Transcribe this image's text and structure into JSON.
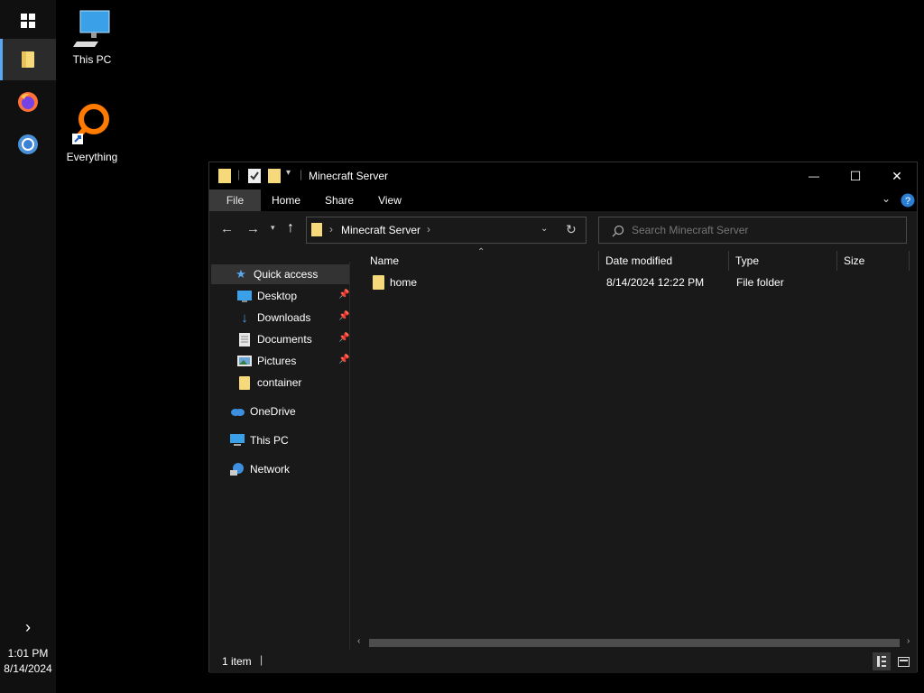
{
  "taskbar": {
    "start_icon": "windows-logo-icon",
    "apps": [
      "file-explorer-icon",
      "firefox-icon",
      "chrome-icon"
    ],
    "chevron": "›",
    "clock": {
      "time": "1:01 PM",
      "date": "8/14/2024"
    }
  },
  "desktop": {
    "icons": [
      {
        "label": "This PC",
        "icon": "computer-icon"
      },
      {
        "label": "Everything",
        "icon": "everything-search-icon"
      }
    ]
  },
  "window": {
    "title": "Minecraft Server",
    "controls": {
      "minimize": "—",
      "maximize": "☐",
      "close": "✕"
    },
    "ribbon_tabs": [
      "File",
      "Home",
      "Share",
      "View"
    ],
    "address": {
      "path": "Minecraft Server",
      "separator_before": "›",
      "separator_after": "›"
    },
    "search": {
      "placeholder": "Search Minecraft Server"
    },
    "nav": {
      "quick_access": "Quick access",
      "items": [
        {
          "label": "Desktop",
          "pinned": true
        },
        {
          "label": "Downloads",
          "pinned": true
        },
        {
          "label": "Documents",
          "pinned": true
        },
        {
          "label": "Pictures",
          "pinned": true
        },
        {
          "label": "container",
          "pinned": false
        }
      ],
      "onedrive": "OneDrive",
      "this_pc": "This PC",
      "network": "Network"
    },
    "columns": [
      "Name",
      "Date modified",
      "Type",
      "Size"
    ],
    "rows": [
      {
        "name": "home",
        "date": "8/14/2024 12:22 PM",
        "type": "File folder",
        "size": ""
      }
    ],
    "status": {
      "count": "1 item"
    }
  },
  "colors": {
    "accent": "#5aa7f2",
    "folder": "#f5d97a",
    "selected_nav": "#333333"
  }
}
